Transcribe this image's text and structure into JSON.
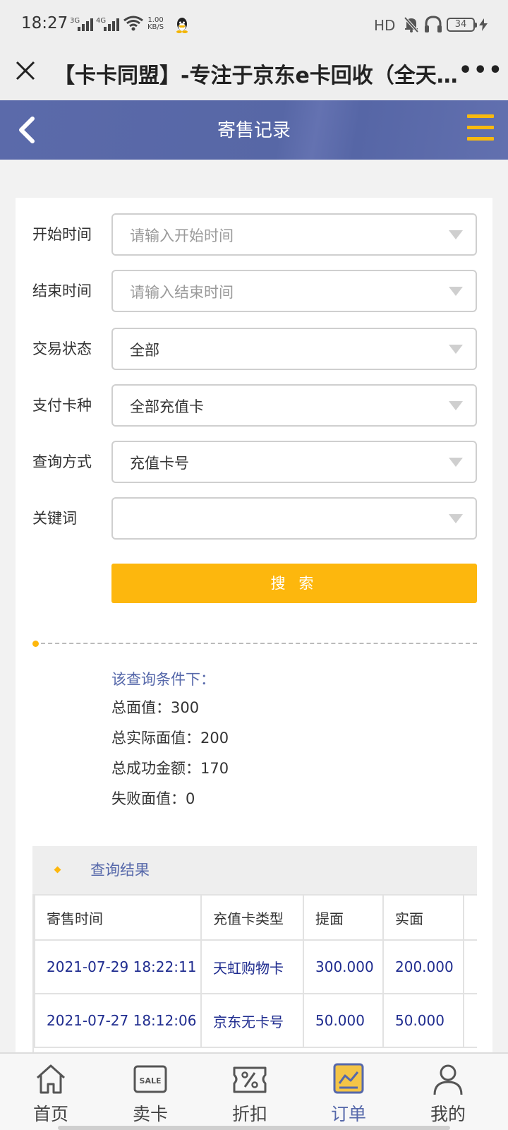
{
  "status_bar": {
    "time": "18:27",
    "signal1_label": "3G",
    "signal2_label": "4G",
    "net_speed_value": "1.00",
    "net_speed_unit": "KB/S",
    "hd_label": "HD",
    "battery": "34"
  },
  "browser": {
    "title": "【卡卡同盟】-专注于京东e卡回收（全天…",
    "more": "•••"
  },
  "header": {
    "title": "寄售记录"
  },
  "form": {
    "start_time": {
      "label": "开始时间",
      "placeholder": "请输入开始时间"
    },
    "end_time": {
      "label": "结束时间",
      "placeholder": "请输入结束时间"
    },
    "status": {
      "label": "交易状态",
      "value": "全部"
    },
    "card_type": {
      "label": "支付卡种",
      "value": "全部充值卡"
    },
    "query_method": {
      "label": "查询方式",
      "value": "充值卡号"
    },
    "keyword": {
      "label": "关键词",
      "value": ""
    },
    "search_label": "搜 索"
  },
  "summary": {
    "title": "该查询条件下：",
    "total_face_value": "总面值：300",
    "total_actual_value": "总实际面值：200",
    "total_success_amount": "总成功金额：170",
    "failed_value": "失败面值：0"
  },
  "results": {
    "title": "查询结果",
    "columns": [
      "寄售时间",
      "充值卡类型",
      "提面",
      "实面"
    ],
    "rows": [
      [
        "2021-07-29 18:22:11",
        "天虹购物卡",
        "300.000",
        "200.000"
      ],
      [
        "2021-07-27 18:12:06",
        "京东无卡号",
        "50.000",
        "50.000"
      ]
    ]
  },
  "nav": {
    "items": [
      {
        "label": "首页",
        "icon": "home-icon"
      },
      {
        "label": "卖卡",
        "icon": "sale-icon",
        "icon_text": "SALE"
      },
      {
        "label": "折扣",
        "icon": "discount-icon"
      },
      {
        "label": "订单",
        "icon": "orders-icon",
        "active": true
      },
      {
        "label": "我的",
        "icon": "profile-icon"
      }
    ]
  },
  "colors": {
    "header_bg": "#5b6aaa",
    "accent_yellow": "#fdb70d",
    "link_blue": "#1f2c8f",
    "label_blue": "#5668aa"
  }
}
